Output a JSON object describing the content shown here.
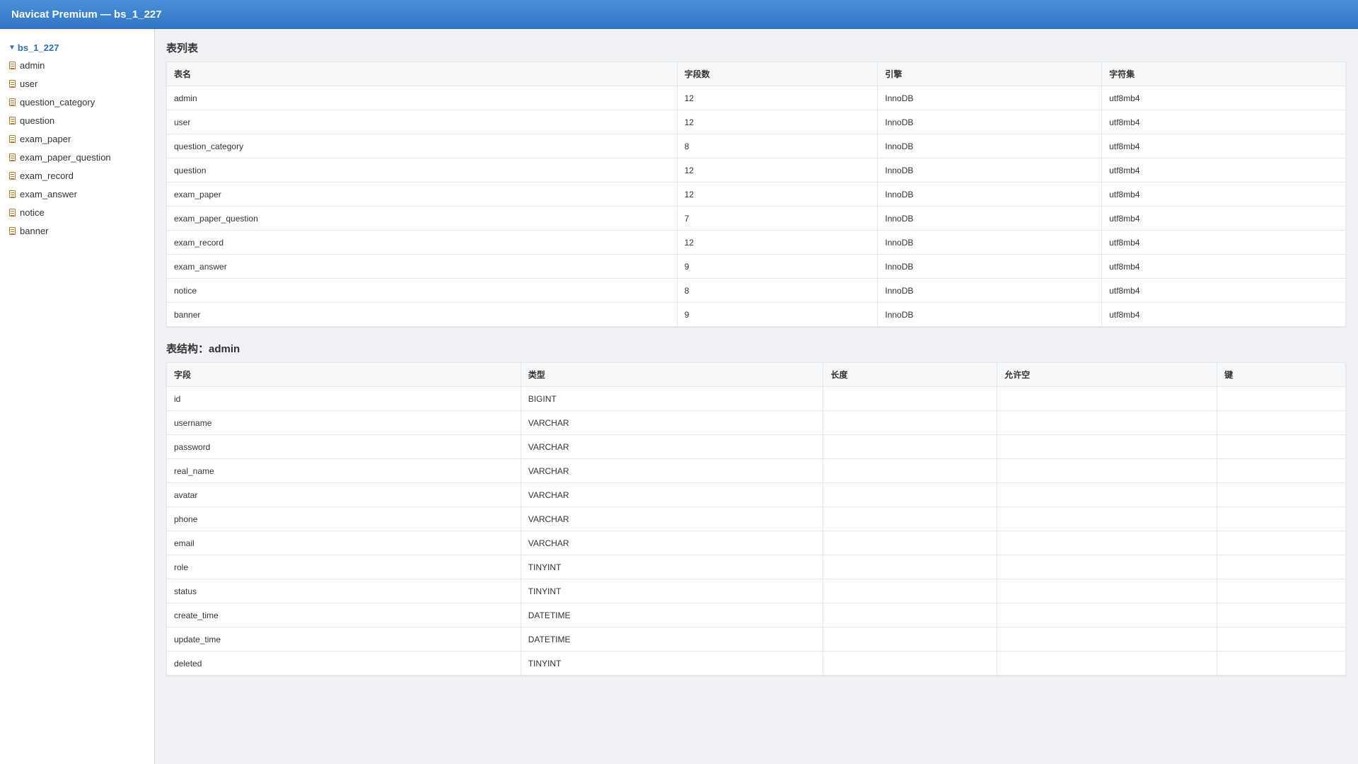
{
  "window": {
    "title": "Navicat Premium — bs_1_227"
  },
  "sidebar": {
    "root": "bs_1_227",
    "items": [
      "admin",
      "user",
      "question_category",
      "question",
      "exam_paper",
      "exam_paper_question",
      "exam_record",
      "exam_answer",
      "notice",
      "banner"
    ]
  },
  "tables_section": {
    "title": "表列表",
    "headers": [
      "表名",
      "字段数",
      "引擎",
      "字符集"
    ],
    "rows": [
      [
        "admin",
        "12",
        "InnoDB",
        "utf8mb4"
      ],
      [
        "user",
        "12",
        "InnoDB",
        "utf8mb4"
      ],
      [
        "question_category",
        "8",
        "InnoDB",
        "utf8mb4"
      ],
      [
        "question",
        "12",
        "InnoDB",
        "utf8mb4"
      ],
      [
        "exam_paper",
        "12",
        "InnoDB",
        "utf8mb4"
      ],
      [
        "exam_paper_question",
        "7",
        "InnoDB",
        "utf8mb4"
      ],
      [
        "exam_record",
        "12",
        "InnoDB",
        "utf8mb4"
      ],
      [
        "exam_answer",
        "9",
        "InnoDB",
        "utf8mb4"
      ],
      [
        "notice",
        "8",
        "InnoDB",
        "utf8mb4"
      ],
      [
        "banner",
        "9",
        "InnoDB",
        "utf8mb4"
      ]
    ]
  },
  "structure_section": {
    "title": "表结构：admin",
    "headers": [
      "字段",
      "类型",
      "长度",
      "允许空",
      "键"
    ],
    "rows": [
      [
        "id",
        "BIGINT",
        "",
        "",
        ""
      ],
      [
        "username",
        "VARCHAR",
        "",
        "",
        ""
      ],
      [
        "password",
        "VARCHAR",
        "",
        "",
        ""
      ],
      [
        "real_name",
        "VARCHAR",
        "",
        "",
        ""
      ],
      [
        "avatar",
        "VARCHAR",
        "",
        "",
        ""
      ],
      [
        "phone",
        "VARCHAR",
        "",
        "",
        ""
      ],
      [
        "email",
        "VARCHAR",
        "",
        "",
        ""
      ],
      [
        "role",
        "TINYINT",
        "",
        "",
        ""
      ],
      [
        "status",
        "TINYINT",
        "",
        "",
        ""
      ],
      [
        "create_time",
        "DATETIME",
        "",
        "",
        ""
      ],
      [
        "update_time",
        "DATETIME",
        "",
        "",
        ""
      ],
      [
        "deleted",
        "TINYINT",
        "",
        "",
        ""
      ]
    ]
  },
  "icons": {
    "tree_caret": "caret-down-icon",
    "table": "table-icon"
  },
  "colors": {
    "titlebar": "#3a83d0",
    "link": "#2a6fba"
  }
}
